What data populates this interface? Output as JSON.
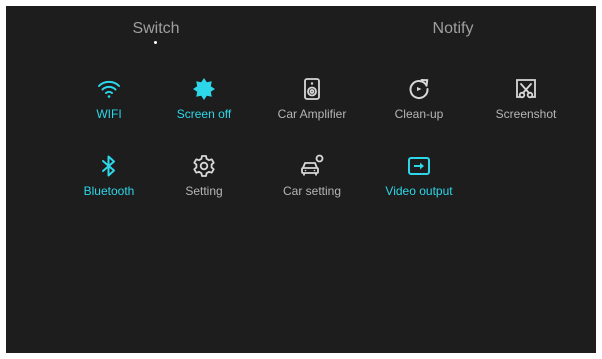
{
  "colors": {
    "accent": "#2dd6e8",
    "inactive": "#b5b5b5",
    "background": "#1d1d1d"
  },
  "tabs": [
    {
      "label": "Switch",
      "selected": true
    },
    {
      "label": "Notify",
      "selected": false
    }
  ],
  "tiles": [
    {
      "label": "WIFI",
      "icon": "wifi-icon",
      "active": true
    },
    {
      "label": "Screen off",
      "icon": "sun-icon",
      "active": true
    },
    {
      "label": "Car Amplifier",
      "icon": "speaker-icon",
      "active": false
    },
    {
      "label": "Clean-up",
      "icon": "refresh-icon",
      "active": false
    },
    {
      "label": "Screenshot",
      "icon": "screenshot-scissors-icon",
      "active": false
    },
    {
      "label": "Bluetooth",
      "icon": "bluetooth-icon",
      "active": true
    },
    {
      "label": "Setting",
      "icon": "gear-icon",
      "active": false
    },
    {
      "label": "Car setting",
      "icon": "car-gear-icon",
      "active": false
    },
    {
      "label": "Video output",
      "icon": "video-output-icon",
      "active": true
    }
  ]
}
